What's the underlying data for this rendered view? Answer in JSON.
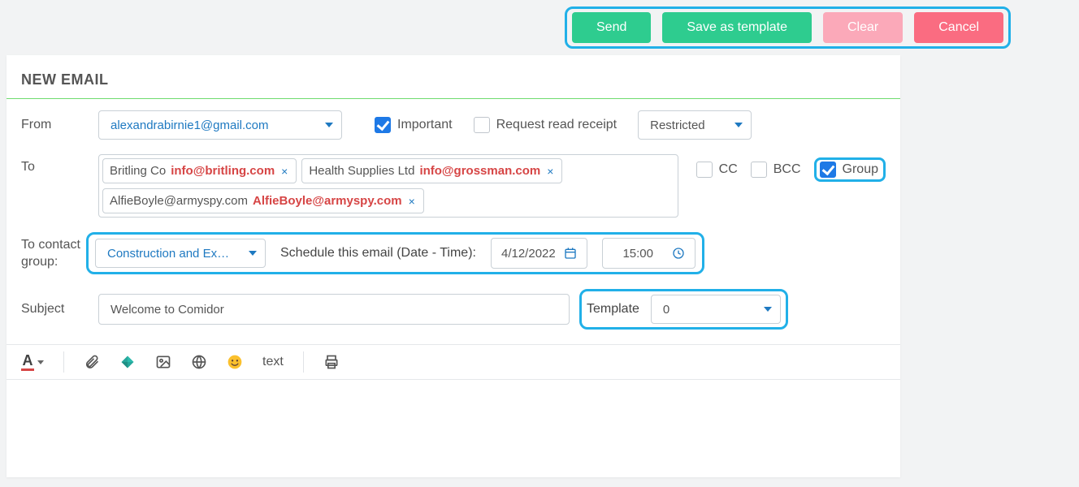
{
  "actions": {
    "send": "Send",
    "save_tpl": "Save as template",
    "clear": "Clear",
    "cancel": "Cancel"
  },
  "panel": {
    "title": "NEW EMAIL"
  },
  "labels": {
    "from": "From",
    "to": "To",
    "to_group": "To contact group:",
    "subject": "Subject",
    "template": "Template"
  },
  "from": {
    "selected": "alexandrabirnie1@gmail.com"
  },
  "flags": {
    "important_label": "Important",
    "important_checked": true,
    "read_receipt_label": "Request read receipt",
    "read_receipt_checked": false
  },
  "visibility": {
    "selected": "Restricted"
  },
  "recipients": [
    {
      "name": "Britling Co",
      "email": "info@britling.com"
    },
    {
      "name": "Health Supplies Ltd",
      "email": "info@grossman.com"
    },
    {
      "name": "AlfieBoyle@armyspy.com",
      "email": "AlfieBoyle@armyspy.com"
    }
  ],
  "ccbcc": {
    "cc_label": "CC",
    "cc_checked": false,
    "bcc_label": "BCC",
    "bcc_checked": false,
    "group_label": "Group",
    "group_checked": true
  },
  "contact_group": {
    "selected": "Construction and Ex…"
  },
  "schedule": {
    "label": "Schedule this email (Date - Time):",
    "date": "4/12/2022",
    "time": "15:00"
  },
  "subject": {
    "value": "Welcome to Comidor"
  },
  "template": {
    "selected": "0"
  },
  "toolbar": {
    "text_label": "text"
  }
}
